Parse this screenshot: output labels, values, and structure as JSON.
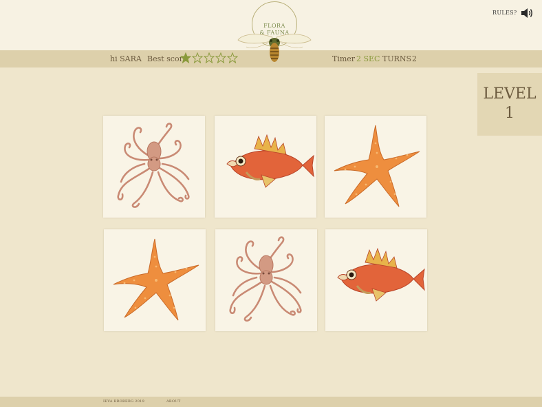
{
  "header": {
    "greeting": "hi SARA",
    "best_score_label": "Best score",
    "best_score_stars": 1,
    "stars_total": 5,
    "timer_label": "Timer",
    "timer_value": "2 SEC",
    "turns_label": "TURNS",
    "turns_value": "2",
    "logo_line1": "FLORA",
    "logo_line2": "& FAUNA",
    "rules_label": "RULES?",
    "speaker_icon": "speaker-icon"
  },
  "level": {
    "label": "LEVEL",
    "number": "1"
  },
  "cards": [
    {
      "creature": "octopus"
    },
    {
      "creature": "fish"
    },
    {
      "creature": "starfish"
    },
    {
      "creature": "starfish"
    },
    {
      "creature": "octopus"
    },
    {
      "creature": "fish"
    }
  ],
  "footer": {
    "credit": "IEVA BROBERG 2019",
    "about": "ABOUT"
  },
  "colors": {
    "background": "#efe6cc",
    "bar": "#ddd0ab",
    "accent_green": "#8a9a3c",
    "card": "#f9f4e6",
    "octopus": "#c98a74",
    "fish": "#e2643a",
    "starfish": "#ee8e3e"
  }
}
